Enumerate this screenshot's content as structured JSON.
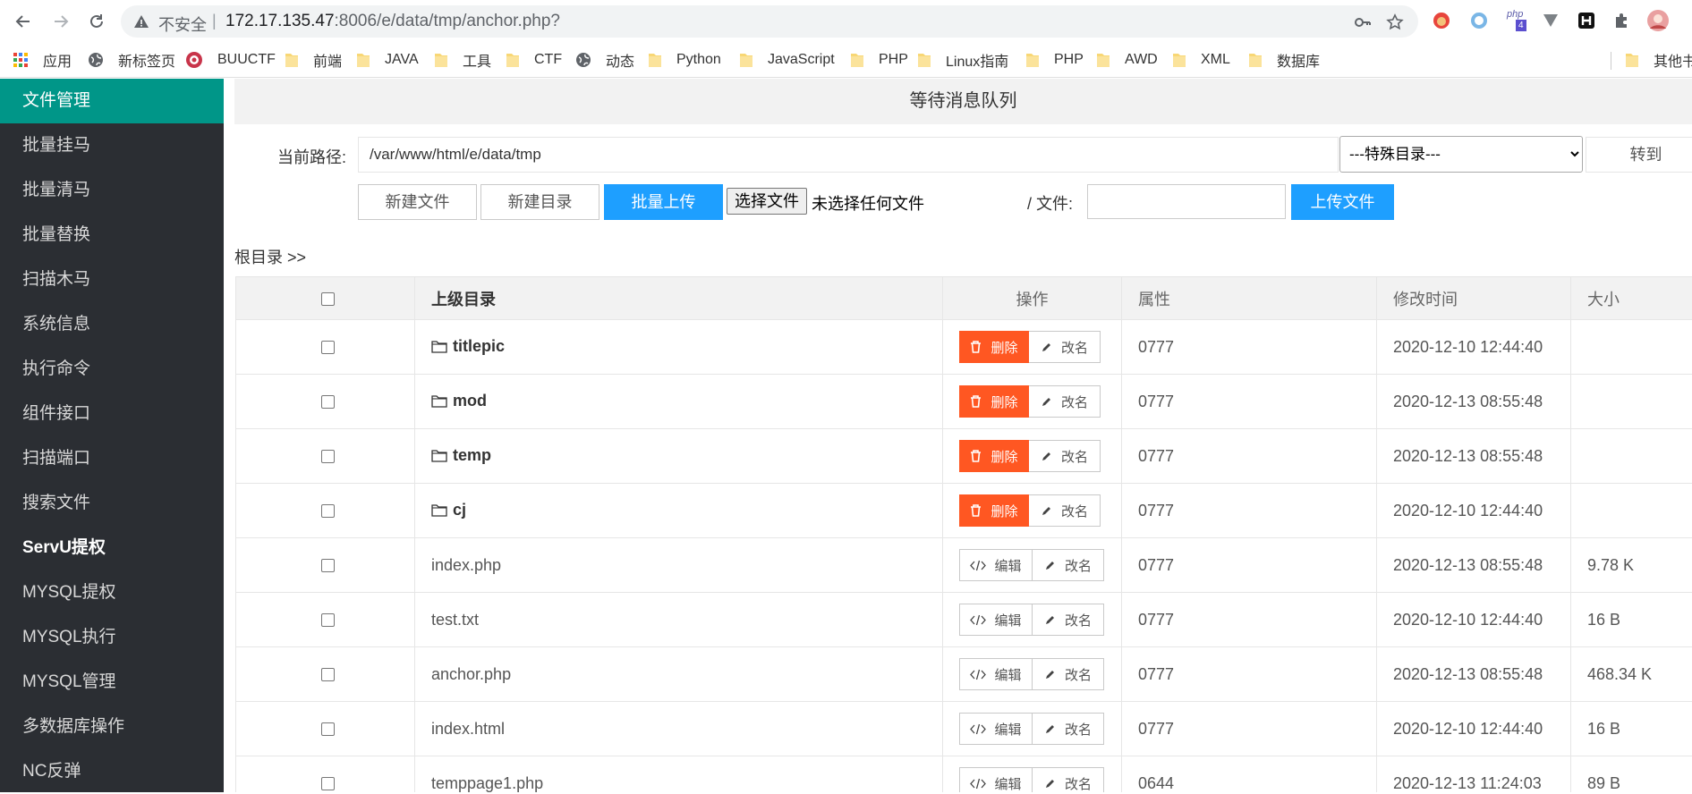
{
  "browser": {
    "insecure_label": "不安全",
    "url_host": "172.17.135.47",
    "url_rest": ":8006/e/data/tmp/anchor.php?",
    "php_ext_badge": "4"
  },
  "bookmarks": [
    {
      "label": "应用",
      "icon": "apps-grid-icon"
    },
    {
      "label": "新标签页",
      "icon": "globe-icon"
    },
    {
      "label": "BUUCTF",
      "icon": "buuctf-icon"
    },
    {
      "label": "前端",
      "icon": "folder-icon"
    },
    {
      "label": "JAVA",
      "icon": "folder-icon"
    },
    {
      "label": "工具",
      "icon": "folder-icon"
    },
    {
      "label": "CTF",
      "icon": "folder-icon"
    },
    {
      "label": "动态",
      "icon": "globe-icon"
    },
    {
      "label": "Python",
      "icon": "folder-icon"
    },
    {
      "label": "JavaScript",
      "icon": "folder-icon"
    },
    {
      "label": "PHP",
      "icon": "folder-icon"
    },
    {
      "label": "Linux指南",
      "icon": "folder-icon"
    },
    {
      "label": "PHP",
      "icon": "folder-icon"
    },
    {
      "label": "AWD",
      "icon": "folder-icon"
    },
    {
      "label": "XML",
      "icon": "folder-icon"
    },
    {
      "label": "数据库",
      "icon": "folder-icon"
    },
    {
      "label": "其他书签",
      "icon": "folder-icon"
    }
  ],
  "sidebar": {
    "items": [
      {
        "label": "文件管理"
      },
      {
        "label": "批量挂马"
      },
      {
        "label": "批量清马"
      },
      {
        "label": "批量替换"
      },
      {
        "label": "扫描木马"
      },
      {
        "label": "系统信息"
      },
      {
        "label": "执行命令"
      },
      {
        "label": "组件接口"
      },
      {
        "label": "扫描端口"
      },
      {
        "label": "搜索文件"
      },
      {
        "label": "ServU提权"
      },
      {
        "label": "MYSQL提权"
      },
      {
        "label": "MYSQL执行"
      },
      {
        "label": "MYSQL管理"
      },
      {
        "label": "多数据库操作"
      },
      {
        "label": "NC反弹"
      }
    ]
  },
  "main": {
    "title": "等待消息队列",
    "path_label": "当前路径:",
    "path_value": "/var/www/html/e/data/tmp",
    "special_dir_option": "---特殊目录---",
    "goto_label": "转到",
    "new_file_label": "新建文件",
    "new_dir_label": "新建目录",
    "batch_upload_label": "批量上传",
    "choose_file_label": "选择文件",
    "no_file_label": "未选择任何文件",
    "file_label": "/ 文件:",
    "upload_label": "上传文件",
    "breadcrumb": "根目录 >>"
  },
  "table": {
    "headers": {
      "name": "上级目录",
      "ops": "操作",
      "attr": "属性",
      "mtime": "修改时间",
      "size": "大小"
    },
    "delete_label": "删除",
    "edit_label": "编辑",
    "rename_label": "改名",
    "rows": [
      {
        "name": "titlepic",
        "dir": true,
        "attr": "0777",
        "mtime": "2020-12-10 12:44:40",
        "size": ""
      },
      {
        "name": "mod",
        "dir": true,
        "attr": "0777",
        "mtime": "2020-12-13 08:55:48",
        "size": ""
      },
      {
        "name": "temp",
        "dir": true,
        "attr": "0777",
        "mtime": "2020-12-13 08:55:48",
        "size": ""
      },
      {
        "name": "cj",
        "dir": true,
        "attr": "0777",
        "mtime": "2020-12-10 12:44:40",
        "size": ""
      },
      {
        "name": "index.php",
        "dir": false,
        "attr": "0777",
        "mtime": "2020-12-13 08:55:48",
        "size": "9.78 K"
      },
      {
        "name": "test.txt",
        "dir": false,
        "attr": "0777",
        "mtime": "2020-12-10 12:44:40",
        "size": "16 B"
      },
      {
        "name": "anchor.php",
        "dir": false,
        "attr": "0777",
        "mtime": "2020-12-13 08:55:48",
        "size": "468.34 K"
      },
      {
        "name": "index.html",
        "dir": false,
        "attr": "0777",
        "mtime": "2020-12-10 12:44:40",
        "size": "16 B"
      },
      {
        "name": "temppage1.php",
        "dir": false,
        "attr": "0644",
        "mtime": "2020-12-13 11:24:03",
        "size": "89 B"
      }
    ]
  }
}
